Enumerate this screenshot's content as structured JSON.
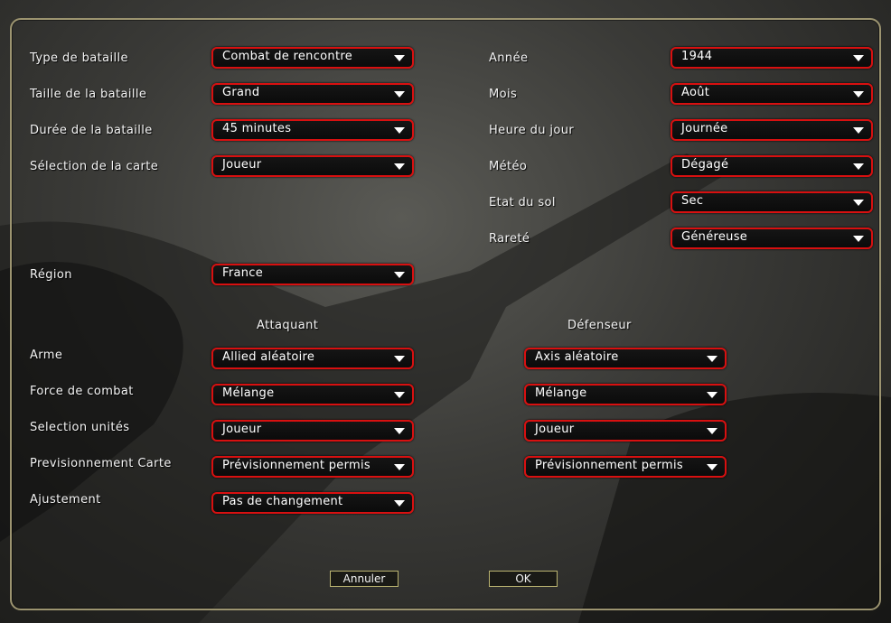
{
  "labels": {
    "type": "Type de bataille",
    "taille": "Taille de la bataille",
    "duree": "Durée de la bataille",
    "carte": "Sélection de la carte",
    "region": "Région",
    "annee": "Année",
    "mois": "Mois",
    "heure": "Heure du jour",
    "meteo": "Météo",
    "sol": "Etat du sol",
    "rarete": "Rareté",
    "arme": "Arme",
    "force": "Force de combat",
    "selection": "Selection unités",
    "prev": "Previsionnement Carte",
    "ajust": "Ajustement"
  },
  "columns": {
    "attaquant": "Attaquant",
    "defenseur": "Défenseur"
  },
  "values": {
    "type": "Combat de rencontre",
    "taille": "Grand",
    "duree": "45 minutes",
    "carte": "Joueur",
    "region": "France",
    "annee": "1944",
    "mois": "Août",
    "heure": "Journée",
    "meteo": "Dégagé",
    "sol": "Sec",
    "rarete": "Généreuse",
    "att_arme": "Allied aléatoire",
    "att_force": "Mélange",
    "att_selection": "Joueur",
    "att_prev": "Prévisionnement permis",
    "att_ajust": "Pas de changement",
    "def_arme": "Axis aléatoire",
    "def_force": "Mélange",
    "def_selection": "Joueur",
    "def_prev": "Prévisionnement permis"
  },
  "buttons": {
    "cancel": "Annuler",
    "ok": "OK"
  },
  "colors": {
    "dropdown_border": "#d81010",
    "panel_border": "#9c9470",
    "button_border": "#b9b370"
  }
}
